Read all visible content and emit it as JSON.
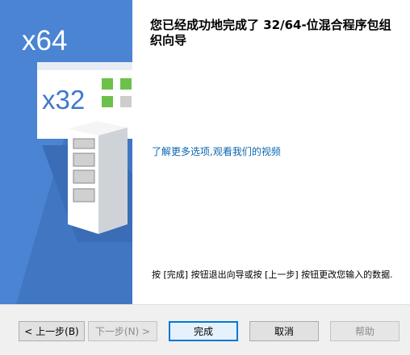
{
  "banner": {
    "big_label": "x64",
    "small_label": "x32",
    "tile_colors": [
      "#6cc14a",
      "#6cc14a",
      "#6cc14a",
      "#cdcdcd"
    ],
    "bg_color": "#4a84d2",
    "shadow_color": "#3c70bb"
  },
  "content": {
    "title": "您已经成功地完成了 32/64-位混合程序包组织向导",
    "link_text": "了解更多选项,观看我们的视频",
    "instruction": "按 [完成] 按钮退出向导或按 [上一步] 按钮更改您输入的数据."
  },
  "buttons": {
    "back": "< 上一步(B)",
    "next": "下一步(N) >",
    "finish": "完成",
    "cancel": "取消",
    "help": "帮助"
  }
}
